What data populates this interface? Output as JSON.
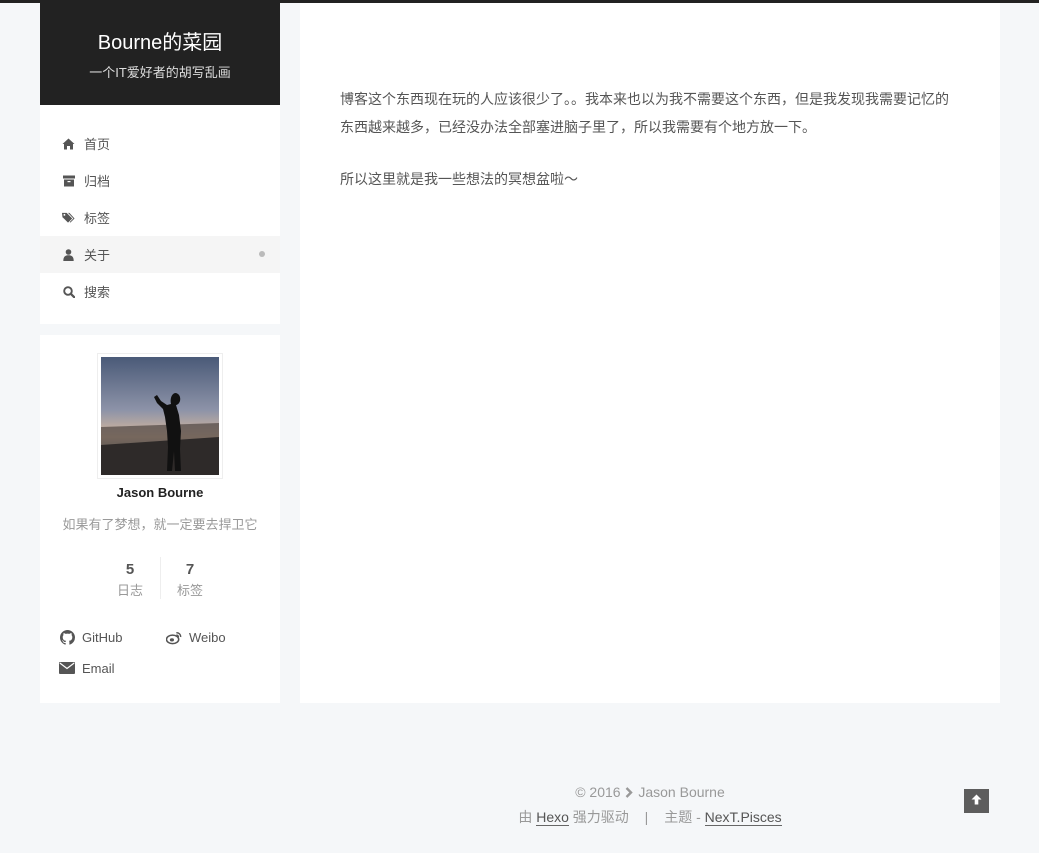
{
  "site": {
    "title": "Bourne的菜园",
    "subtitle": "一个IT爱好者的胡写乱画"
  },
  "menu": {
    "items": [
      {
        "label": "首页",
        "icon": "home-icon"
      },
      {
        "label": "归档",
        "icon": "archive-icon"
      },
      {
        "label": "标签",
        "icon": "tags-icon"
      },
      {
        "label": "关于",
        "icon": "user-icon",
        "active": true
      },
      {
        "label": "搜索",
        "icon": "search-icon"
      }
    ]
  },
  "profile": {
    "name": "Jason Bourne",
    "motto": "如果有了梦想，就一定要去捍卫它",
    "stats": [
      {
        "count": "5",
        "label": "日志"
      },
      {
        "count": "7",
        "label": "标签"
      }
    ],
    "links": [
      {
        "label": "GitHub",
        "icon": "github-icon"
      },
      {
        "label": "Weibo",
        "icon": "weibo-icon"
      },
      {
        "label": "Email",
        "icon": "envelope-icon"
      }
    ]
  },
  "content": {
    "paragraphs": [
      "博客这个东西现在玩的人应该很少了。。我本来也以为我不需要这个东西，但是我发现我需要记忆的东西越来越多，已经没办法全部塞进脑子里了，所以我需要有个地方放一下。",
      "所以这里就是我一些想法的冥想盆啦～"
    ]
  },
  "footer": {
    "copyright": "© 2016",
    "author": "Jason Bourne",
    "powered_prefix": "由",
    "powered_link": "Hexo",
    "powered_suffix": "强力驱动",
    "separator": "|",
    "theme_prefix": "主题 -",
    "theme_link": "NexT.Pisces"
  },
  "colors": {
    "header_bg": "#222222",
    "page_bg": "#f5f7f9",
    "text": "#555555",
    "muted": "#999999"
  }
}
